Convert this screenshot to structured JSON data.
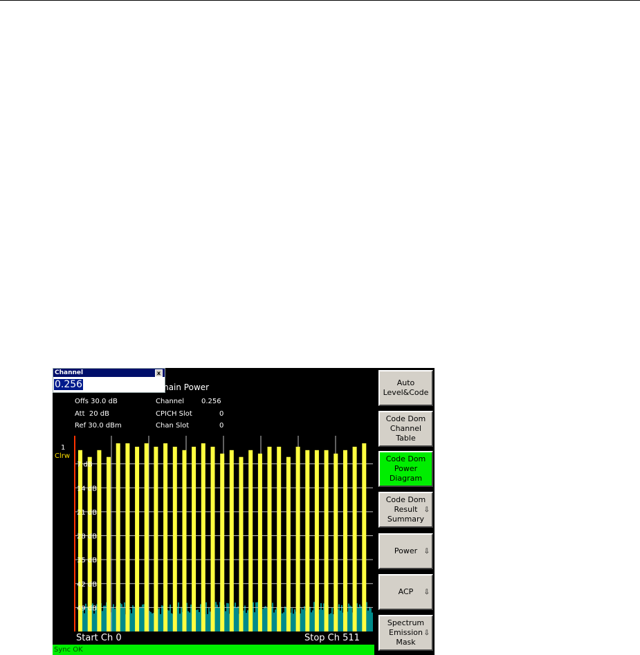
{
  "dialog": {
    "title": "Channel",
    "value": "0.256",
    "close_glyph": "x"
  },
  "header": {
    "title": "main Power",
    "left": [
      "Offs 30.0 dB",
      "Att  20 dB",
      "Ref 30.0 dBm"
    ],
    "mid_labels": [
      "Channel",
      "CPICH Slot",
      "Chan Slot"
    ],
    "mid_values": [
      "0.256",
      "0",
      "0"
    ]
  },
  "trace": {
    "number": "1",
    "mode": "Clrw"
  },
  "footer": {
    "start": "Start Ch 0",
    "stop": "Stop Ch 511",
    "status": "Sync OK"
  },
  "softkeys": [
    {
      "label": "Auto\nLevel&Code",
      "arrow": "",
      "active": false
    },
    {
      "label": "Code Dom\nChannel\nTable",
      "arrow": "",
      "active": false
    },
    {
      "label": "Code Dom\nPower\nDiagram",
      "arrow": "",
      "active": true
    },
    {
      "label": "Code Dom\nResult\nSummary",
      "arrow": "⇩",
      "active": false
    },
    {
      "label": "Power",
      "arrow": "⇩",
      "active": false
    },
    {
      "label": "ACP",
      "arrow": "⇩",
      "active": false
    },
    {
      "label": "Spectrum\nEmission\nMask",
      "arrow": "⇩",
      "active": false
    }
  ],
  "chart_data": {
    "type": "bar",
    "y_tick_labels": [
      "7 dB",
      "14 dB",
      "21 dB",
      "28 dB",
      "35 dB",
      "42 dB",
      "49 dB"
    ],
    "ylim": [
      0,
      56
    ],
    "x_range": [
      0,
      511
    ],
    "noise_floor_db": -49,
    "channel_powers_db": [
      -3,
      -5,
      -3,
      -5,
      -1,
      -1,
      -2,
      -1,
      -2,
      -1,
      -2,
      -3,
      -2,
      -1,
      -2,
      -4,
      -3,
      -5,
      -3,
      -4,
      -2,
      -2,
      -5,
      -2,
      -3,
      -3,
      -3,
      -4,
      -3,
      -2,
      -1
    ],
    "colors": {
      "bars": "#ffff40",
      "noise": "#008b8b",
      "grid": "#c0c0c0",
      "marker": "#ff3300"
    }
  }
}
